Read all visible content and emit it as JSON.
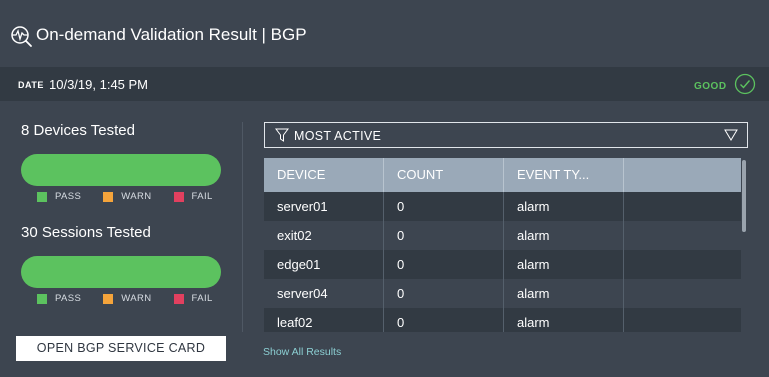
{
  "header": {
    "title": "On-demand Validation Result | BGP",
    "icon": "validation-pulse-icon"
  },
  "datebar": {
    "label": "DATE",
    "value": "10/3/19, 1:45 PM",
    "status": "GOOD",
    "status_color": "#5cc25f"
  },
  "devices": {
    "title": "8 Devices Tested",
    "bar_color": "#5cc25f",
    "pass_fraction": 1.0,
    "legend": [
      {
        "label": "PASS",
        "color": "#5cc25f"
      },
      {
        "label": "WARN",
        "color": "#f5a43b"
      },
      {
        "label": "FAIL",
        "color": "#e2405f"
      }
    ]
  },
  "sessions": {
    "title": "30 Sessions Tested",
    "bar_color": "#5cc25f",
    "pass_fraction": 1.0,
    "legend": [
      {
        "label": "PASS",
        "color": "#5cc25f"
      },
      {
        "label": "WARN",
        "color": "#f5a43b"
      },
      {
        "label": "FAIL",
        "color": "#e2405f"
      }
    ]
  },
  "open_button": "OPEN BGP SERVICE CARD",
  "filter": {
    "label": "MOST ACTIVE",
    "icon": "filter-icon"
  },
  "table": {
    "columns": [
      "DEVICE",
      "COUNT",
      "EVENT TY...",
      ""
    ],
    "rows": [
      [
        "server01",
        "0",
        "alarm",
        ""
      ],
      [
        "exit02",
        "0",
        "alarm",
        ""
      ],
      [
        "edge01",
        "0",
        "alarm",
        ""
      ],
      [
        "server04",
        "0",
        "alarm",
        ""
      ],
      [
        "leaf02",
        "0",
        "alarm",
        ""
      ]
    ]
  },
  "show_all": "Show All Results"
}
